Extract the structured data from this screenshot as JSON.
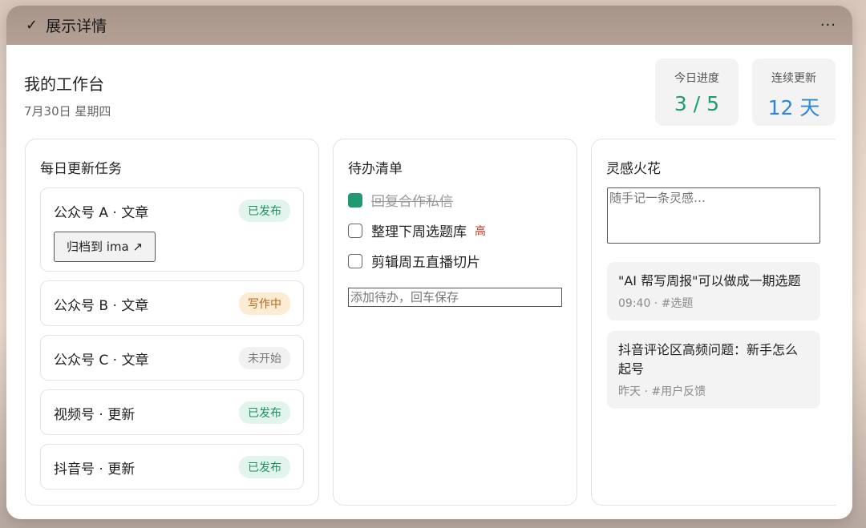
{
  "titlebar": {
    "check_glyph": "✓",
    "title": "展示详情",
    "more_glyph": "···"
  },
  "header": {
    "title": "我的工作台",
    "date": "7月30日 星期四"
  },
  "stats": {
    "progress": {
      "label": "今日进度",
      "value": "3 / 5"
    },
    "streak": {
      "label": "连续更新",
      "value": "12 天"
    }
  },
  "tasks_panel": {
    "title": "每日更新任务",
    "items": [
      {
        "name": "公众号 A · 文章",
        "status": "已发布",
        "status_color": "green",
        "action": "归档到 ima ↗"
      },
      {
        "name": "公众号 B · 文章",
        "status": "写作中",
        "status_color": "orange"
      },
      {
        "name": "公众号 C · 文章",
        "status": "未开始",
        "status_color": "gray"
      },
      {
        "name": "视频号 · 更新",
        "status": "已发布",
        "status_color": "green"
      },
      {
        "name": "抖音号 · 更新",
        "status": "已发布",
        "status_color": "green"
      }
    ]
  },
  "todo_panel": {
    "title": "待办清单",
    "items": [
      {
        "text": "回复合作私信",
        "done": true
      },
      {
        "text": "整理下周选题库",
        "done": false,
        "priority": "高"
      },
      {
        "text": "剪辑周五直播切片",
        "done": false
      }
    ],
    "input_placeholder": "添加待办，回车保存"
  },
  "ideas_panel": {
    "title": "灵感火花",
    "input_placeholder": "随手记一条灵感…",
    "notes": [
      {
        "text": "\"AI 帮写周报\"可以做成一期选题",
        "meta": "09:40 · #选题"
      },
      {
        "text": "抖音评论区高频问题：新手怎么起号",
        "meta": "昨天 · #用户反馈"
      }
    ]
  },
  "colors": {
    "green": "#1f9a71",
    "blue": "#2d87d6",
    "orange": "#b06a17",
    "red": "#c0392b"
  }
}
